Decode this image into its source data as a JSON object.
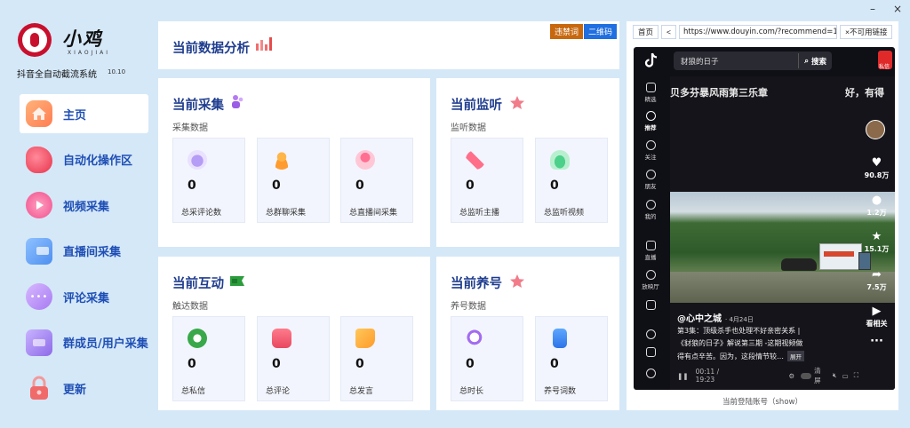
{
  "window": {
    "minimize": "–",
    "close": "×"
  },
  "brand": {
    "name": "小鸡",
    "sub": "XIAOJIAI",
    "app_name": "抖音全自动截流系统",
    "version": "10.10"
  },
  "nav": [
    {
      "label": "主页",
      "icon": "home-icon",
      "active": true
    },
    {
      "label": "自动化操作区",
      "icon": "automation-icon"
    },
    {
      "label": "视频采集",
      "icon": "video-collect-icon"
    },
    {
      "label": "直播间采集",
      "icon": "live-collect-icon"
    },
    {
      "label": "评论采集",
      "icon": "comment-collect-icon"
    },
    {
      "label": "群成员/用户采集",
      "icon": "group-user-icon"
    },
    {
      "label": "更新",
      "icon": "lock-icon"
    }
  ],
  "header": {
    "title": "当前数据分析",
    "btn_banned": "违禁词",
    "btn_qr": "二维码"
  },
  "panels": {
    "collect": {
      "title": "当前采集",
      "subtitle": "采集数据",
      "cards": [
        {
          "value": "0",
          "label": "总采评论数"
        },
        {
          "value": "0",
          "label": "总群聊采集"
        },
        {
          "value": "0",
          "label": "总直播间采集"
        }
      ]
    },
    "monitor": {
      "title": "当前监听",
      "subtitle": "监听数据",
      "cards": [
        {
          "value": "0",
          "label": "总监听主播"
        },
        {
          "value": "0",
          "label": "总监听视频"
        }
      ]
    },
    "interact": {
      "title": "当前互动",
      "subtitle": "触达数据",
      "cards": [
        {
          "value": "0",
          "label": "总私信"
        },
        {
          "value": "0",
          "label": "总评论"
        },
        {
          "value": "0",
          "label": "总发言"
        }
      ]
    },
    "nurture": {
      "title": "当前养号",
      "subtitle": "养号数据",
      "cards": [
        {
          "value": "0",
          "label": "总时长"
        },
        {
          "value": "0",
          "label": "养号词数"
        }
      ]
    }
  },
  "browser": {
    "home": "首页",
    "back": "<",
    "url": "https://www.douyin.com/?recommend=1",
    "unavailable": "×不可用链接",
    "footer": "当前登陆账号（show）"
  },
  "douyin": {
    "search_text": "豺狼的日子",
    "search_btn": "搜索",
    "private_msg": "私信",
    "top_left": "贝多芬暴风雨第三乐章",
    "top_right": "好，有得",
    "author": "@心中之城",
    "date": "· 4月24日",
    "desc1": "第3集：顶级杀手也处理不好亲密关系 |",
    "desc2": "《豺狼的日子》解说第三期 -这期视频做",
    "desc3": "得有点辛苦。因为，这段情节较…",
    "expand": "展开",
    "likes": "90.8万",
    "comments": "1.2万",
    "favorites": "15.1万",
    "shares": "7.5万",
    "more_label": "看相关",
    "time": "00:11 / 19:23",
    "clear": "清屏",
    "left_nav": [
      "精选",
      "推荐",
      "关注",
      "朋友",
      "我的",
      "直播",
      "放映厅"
    ]
  }
}
